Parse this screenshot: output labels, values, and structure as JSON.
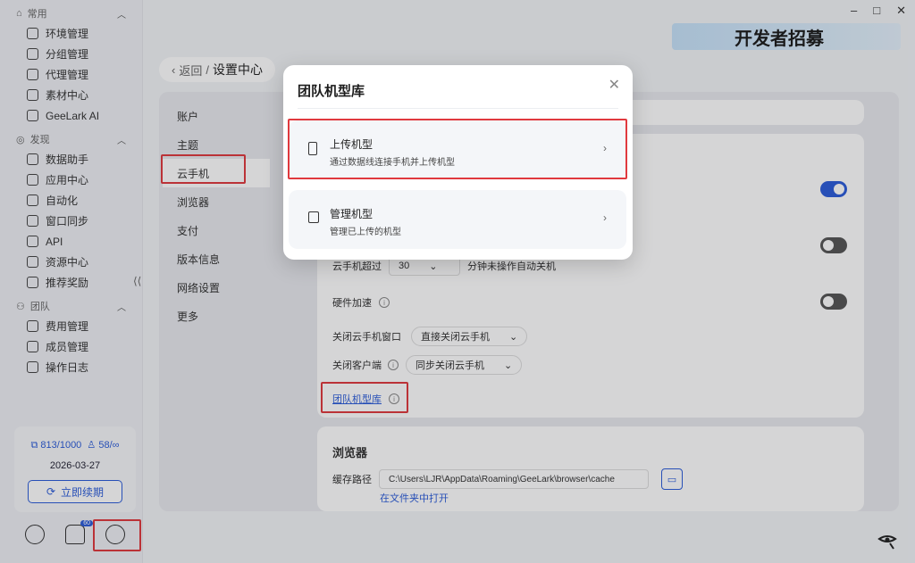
{
  "window": {
    "minimize": "–",
    "maximize": "□",
    "close": "✕"
  },
  "banner": {
    "text": "开发者招募"
  },
  "sidebar": {
    "sections": [
      {
        "title": "常用",
        "items": [
          "环境管理",
          "分组管理",
          "代理管理",
          "素材中心",
          "GeeLark AI"
        ]
      },
      {
        "title": "发现",
        "items": [
          "数据助手",
          "应用中心",
          "自动化",
          "窗口同步",
          "API",
          "资源中心",
          "推荐奖励"
        ]
      },
      {
        "title": "团队",
        "items": [
          "费用管理",
          "成员管理",
          "操作日志"
        ]
      }
    ],
    "collapse": "⟨⟨",
    "quota": {
      "devices": "813/1000",
      "members": "58/∞"
    },
    "expiry": "2026-03-27",
    "renew_label": "立即续期",
    "notification_badge": "60"
  },
  "header": {
    "back_label": "返回",
    "separator": "/",
    "current": "设置中心"
  },
  "settings_menu": [
    "账户",
    "主题",
    "云手机",
    "浏览器",
    "支付",
    "版本信息",
    "网络设置",
    "更多"
  ],
  "cloud_phone": {
    "timeout_prefix": "云手机超过",
    "timeout_value": "30",
    "timeout_suffix": "分钟未操作自动关机",
    "hw_accel_label": "硬件加速",
    "close_window_label": "关闭云手机窗口",
    "close_window_value": "直接关闭云手机",
    "close_client_label": "关闭客户端",
    "close_client_value": "同步关闭云手机",
    "model_library_link": "团队机型库"
  },
  "browser": {
    "title": "浏览器",
    "cache_label": "缓存路径",
    "cache_path": "C:\\Users\\LJR\\AppData\\Roaming\\GeeLark\\browser\\cache",
    "open_in_folder": "在文件夹中打开"
  },
  "modal": {
    "title": "团队机型库",
    "close": "✕",
    "options": [
      {
        "title": "上传机型",
        "desc": "通过数据线连接手机并上传机型"
      },
      {
        "title": "管理机型",
        "desc": "管理已上传的机型"
      }
    ]
  },
  "colors": {
    "accent": "#2b5cd9",
    "highlight": "#e0393e"
  }
}
